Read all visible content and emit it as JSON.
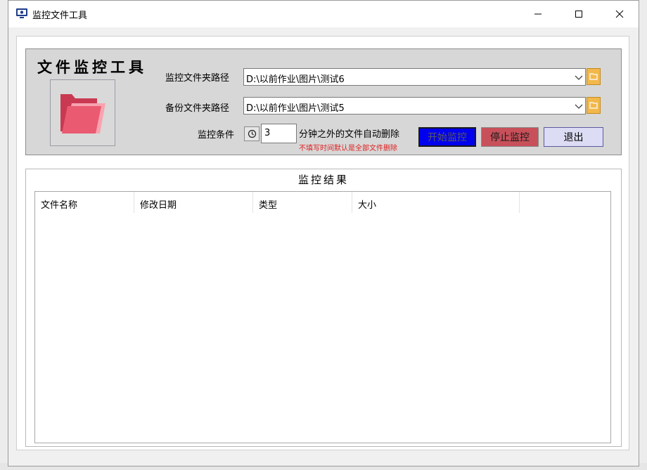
{
  "window": {
    "title": "监控文件工具"
  },
  "header": {
    "tool_title": "文件监控工具"
  },
  "form": {
    "monitor_label": "监控文件夹路径",
    "monitor_path": "D:\\以前作业\\图片\\测试6",
    "backup_label": "备份文件夹路径",
    "backup_path": "D:\\以前作业\\图片\\测试5",
    "condition_label": "监控条件",
    "minutes": "3",
    "condition_text": "分钟之外的文件自动删除",
    "hint": "不填写时间默认是全部文件删除"
  },
  "buttons": {
    "start": "开始监控",
    "stop": "停止监控",
    "exit": "退出"
  },
  "results": {
    "title": "监控结果",
    "columns": [
      "文件名称",
      "修改日期",
      "类型",
      "大小"
    ]
  },
  "colors": {
    "start_bg": "#0000ee",
    "stop_bg": "#c8505a",
    "exit_bg": "#dcdcf4",
    "panel_bg": "#d7d7d7",
    "folder_pink": "#e8566c"
  },
  "icons": {
    "app": "monitor-icon",
    "folder": "folder-icon",
    "clock": "clock-icon",
    "dropdown": "chevron-down-icon"
  }
}
